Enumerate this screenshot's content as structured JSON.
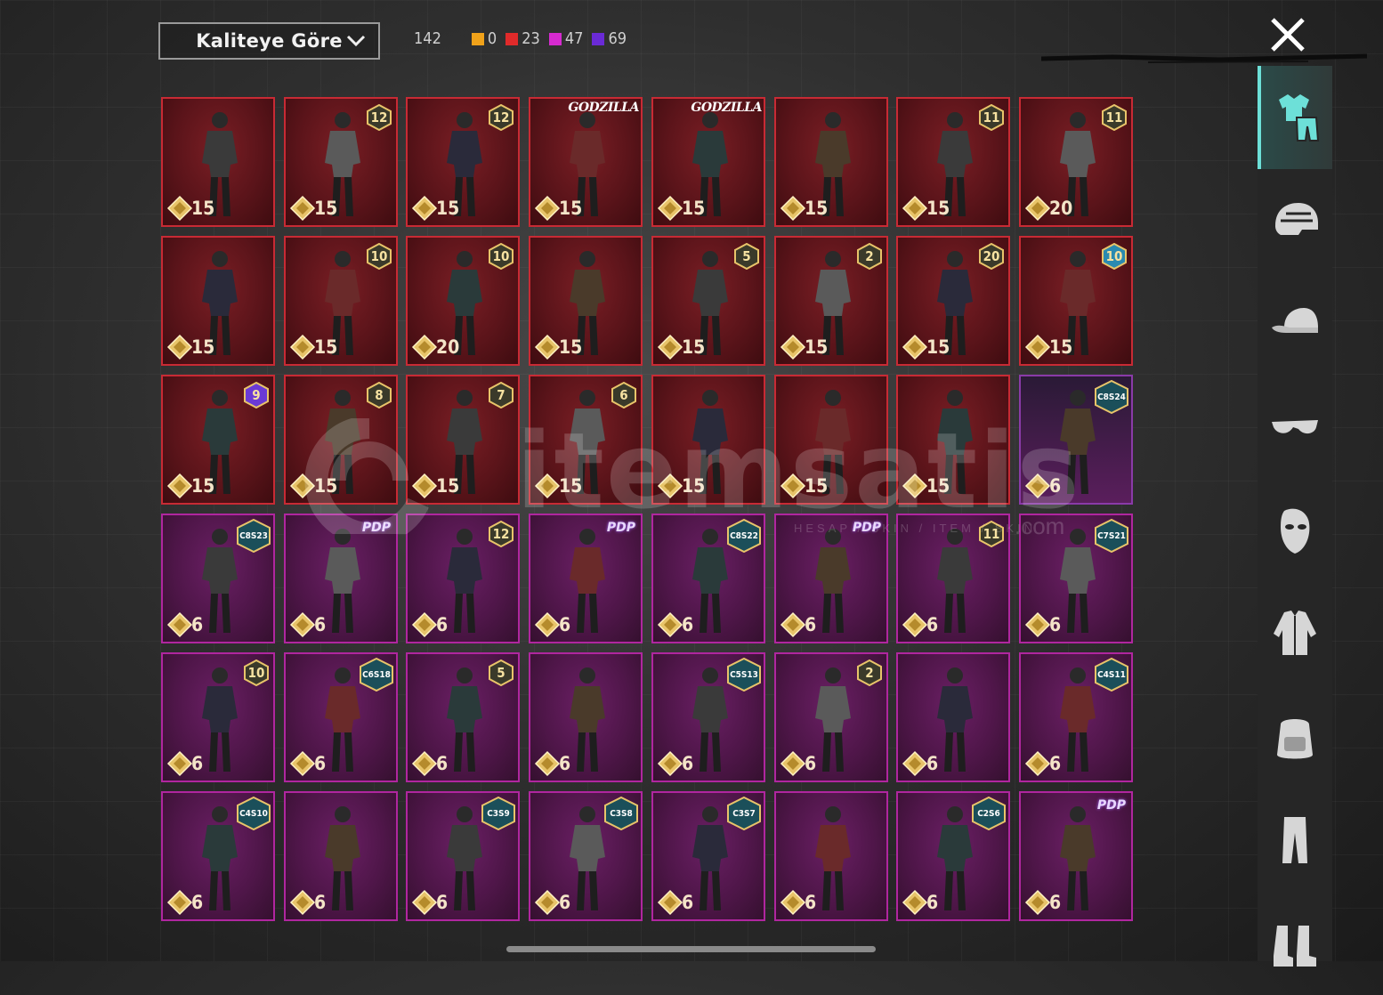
{
  "toolbar": {
    "sort_label": "Kaliteye Göre",
    "total_count": "142",
    "counts": [
      {
        "value": "0",
        "color": "#f0a21a"
      },
      {
        "value": "23",
        "color": "#e02a2a"
      },
      {
        "value": "47",
        "color": "#d62ad0"
      },
      {
        "value": "69",
        "color": "#6a2ad6"
      }
    ]
  },
  "watermark": {
    "text": "itemsatis",
    "sub": "HESAP / SKIN / ITEM / SKIN",
    "com": ".com"
  },
  "sidebar": {
    "items": [
      {
        "icon": "outfit-icon",
        "active": true
      },
      {
        "icon": "helmet-icon"
      },
      {
        "icon": "cap-icon"
      },
      {
        "icon": "glasses-icon"
      },
      {
        "icon": "mask-icon"
      },
      {
        "icon": "jacket-icon"
      },
      {
        "icon": "backpack-icon"
      },
      {
        "icon": "pants-icon"
      },
      {
        "icon": "boots-icon"
      }
    ]
  },
  "cards": [
    {
      "pts": "15",
      "tier": "red",
      "badge": null
    },
    {
      "pts": "15",
      "tier": "red",
      "badge": {
        "type": "num",
        "value": "12"
      }
    },
    {
      "pts": "15",
      "tier": "red",
      "badge": {
        "type": "num",
        "value": "12"
      }
    },
    {
      "pts": "15",
      "tier": "red",
      "badge": {
        "type": "godzilla",
        "value": "GODZILLA"
      }
    },
    {
      "pts": "15",
      "tier": "red",
      "badge": {
        "type": "godzilla",
        "value": "GODZILLA"
      }
    },
    {
      "pts": "15",
      "tier": "red",
      "badge": null
    },
    {
      "pts": "15",
      "tier": "red",
      "badge": {
        "type": "num",
        "value": "11"
      }
    },
    {
      "pts": "20",
      "tier": "red",
      "badge": {
        "type": "num",
        "value": "11"
      }
    },
    {
      "pts": "15",
      "tier": "red",
      "badge": null
    },
    {
      "pts": "15",
      "tier": "red",
      "badge": {
        "type": "num",
        "value": "10"
      }
    },
    {
      "pts": "20",
      "tier": "red",
      "badge": {
        "type": "num",
        "value": "10"
      }
    },
    {
      "pts": "15",
      "tier": "red",
      "badge": null
    },
    {
      "pts": "15",
      "tier": "red",
      "badge": {
        "type": "num",
        "value": "5"
      }
    },
    {
      "pts": "15",
      "tier": "red",
      "badge": {
        "type": "num",
        "value": "2"
      }
    },
    {
      "pts": "15",
      "tier": "red",
      "badge": {
        "type": "num",
        "value": "20"
      }
    },
    {
      "pts": "15",
      "tier": "red",
      "badge": {
        "type": "num",
        "value": "10"
      }
    },
    {
      "pts": "15",
      "tier": "red",
      "badge": {
        "type": "num",
        "value": "9"
      }
    },
    {
      "pts": "15",
      "tier": "red",
      "badge": {
        "type": "num",
        "value": "8"
      }
    },
    {
      "pts": "15",
      "tier": "red",
      "badge": {
        "type": "num",
        "value": "7"
      }
    },
    {
      "pts": "15",
      "tier": "red",
      "badge": {
        "type": "num",
        "value": "6"
      }
    },
    {
      "pts": "15",
      "tier": "red",
      "badge": null
    },
    {
      "pts": "15",
      "tier": "red",
      "badge": null
    },
    {
      "pts": "15",
      "tier": "red",
      "badge": null
    },
    {
      "pts": "6",
      "tier": "purple2",
      "badge": {
        "type": "season",
        "value": "C8S24"
      }
    },
    {
      "pts": "6",
      "tier": "purple",
      "badge": {
        "type": "season",
        "value": "C8S23"
      }
    },
    {
      "pts": "6",
      "tier": "purple",
      "badge": {
        "type": "pdp",
        "value": "PDP"
      }
    },
    {
      "pts": "6",
      "tier": "purple",
      "badge": {
        "type": "num",
        "value": "12"
      }
    },
    {
      "pts": "6",
      "tier": "purple",
      "badge": {
        "type": "pdp",
        "value": "PDP"
      }
    },
    {
      "pts": "6",
      "tier": "purple",
      "badge": {
        "type": "season",
        "value": "C8S22"
      }
    },
    {
      "pts": "6",
      "tier": "purple",
      "badge": {
        "type": "pdp",
        "value": "PDP"
      }
    },
    {
      "pts": "6",
      "tier": "purple",
      "badge": {
        "type": "num",
        "value": "11"
      }
    },
    {
      "pts": "6",
      "tier": "purple",
      "badge": {
        "type": "season",
        "value": "C7S21"
      }
    },
    {
      "pts": "6",
      "tier": "purple",
      "badge": {
        "type": "num",
        "value": "10"
      }
    },
    {
      "pts": "6",
      "tier": "purple",
      "badge": {
        "type": "season",
        "value": "C6S18"
      }
    },
    {
      "pts": "6",
      "tier": "purple",
      "badge": {
        "type": "num",
        "value": "5"
      }
    },
    {
      "pts": "6",
      "tier": "purple",
      "badge": null
    },
    {
      "pts": "6",
      "tier": "purple",
      "badge": {
        "type": "season",
        "value": "C5S13"
      }
    },
    {
      "pts": "6",
      "tier": "purple",
      "badge": {
        "type": "num",
        "value": "2"
      }
    },
    {
      "pts": "6",
      "tier": "purple",
      "badge": null
    },
    {
      "pts": "6",
      "tier": "purple",
      "badge": {
        "type": "season",
        "value": "C4S11"
      }
    },
    {
      "pts": "6",
      "tier": "purple",
      "badge": {
        "type": "season",
        "value": "C4S10"
      }
    },
    {
      "pts": "6",
      "tier": "purple",
      "badge": null
    },
    {
      "pts": "6",
      "tier": "purple",
      "badge": {
        "type": "season",
        "value": "C3S9"
      }
    },
    {
      "pts": "6",
      "tier": "purple",
      "badge": {
        "type": "season",
        "value": "C3S8"
      }
    },
    {
      "pts": "6",
      "tier": "purple",
      "badge": {
        "type": "season",
        "value": "C3S7"
      }
    },
    {
      "pts": "6",
      "tier": "purple",
      "badge": null
    },
    {
      "pts": "6",
      "tier": "purple",
      "badge": {
        "type": "season",
        "value": "C2S6"
      }
    },
    {
      "pts": "6",
      "tier": "purple",
      "badge": {
        "type": "pdp",
        "value": "PDP"
      }
    }
  ]
}
